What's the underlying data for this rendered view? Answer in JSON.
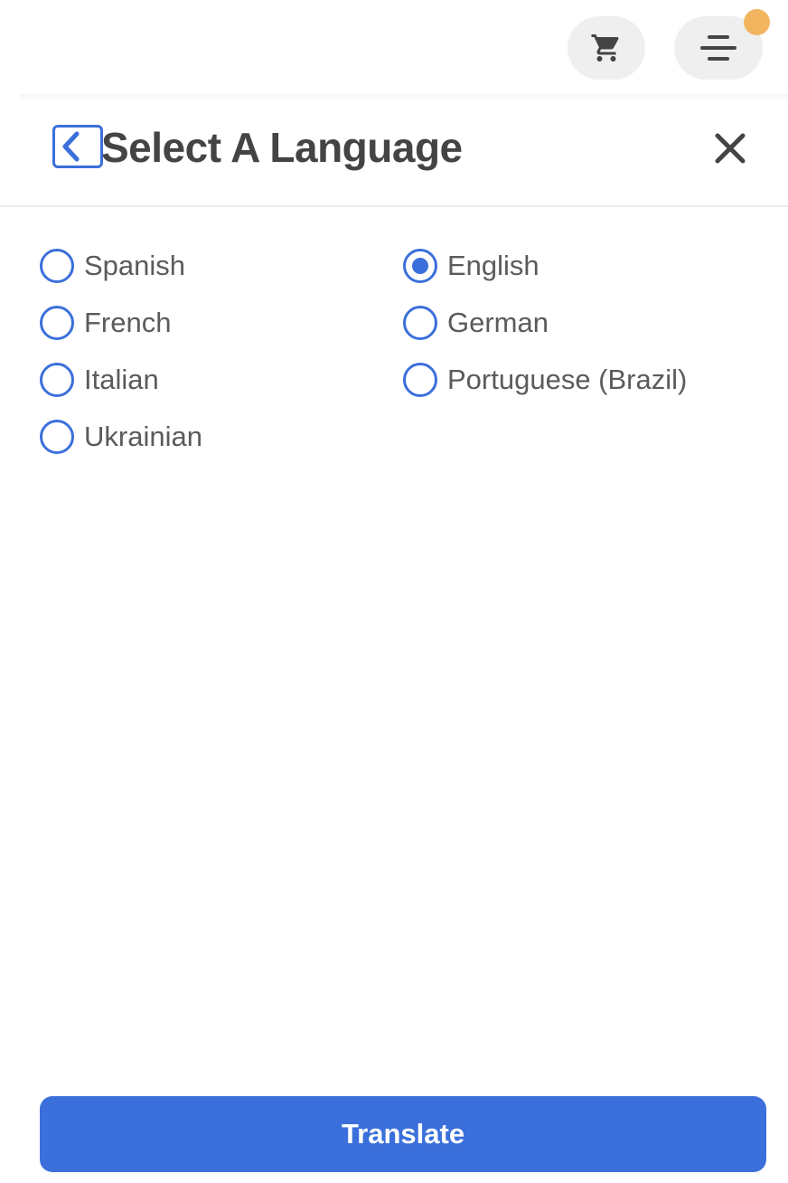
{
  "topbar": {
    "cart_icon": "cart-icon",
    "menu_icon": "menu-icon",
    "notification_color": "#f2b55f"
  },
  "modal": {
    "title": "Select A Language",
    "back_icon": "chevron-left-icon",
    "close_icon": "close-icon"
  },
  "languages": {
    "spanish": {
      "label": "Spanish",
      "selected": false
    },
    "french": {
      "label": "French",
      "selected": false
    },
    "italian": {
      "label": "Italian",
      "selected": false
    },
    "ukrainian": {
      "label": "Ukrainian",
      "selected": false
    },
    "english": {
      "label": "English",
      "selected": true
    },
    "german": {
      "label": "German",
      "selected": false
    },
    "portuguese_brazil": {
      "label": "Portuguese (Brazil)",
      "selected": false
    }
  },
  "footer": {
    "translate_label": "Translate"
  },
  "colors": {
    "accent": "#3b6fdb",
    "title_text": "#444444",
    "body_text": "#5b5b5b",
    "pill_bg": "#efefef"
  }
}
